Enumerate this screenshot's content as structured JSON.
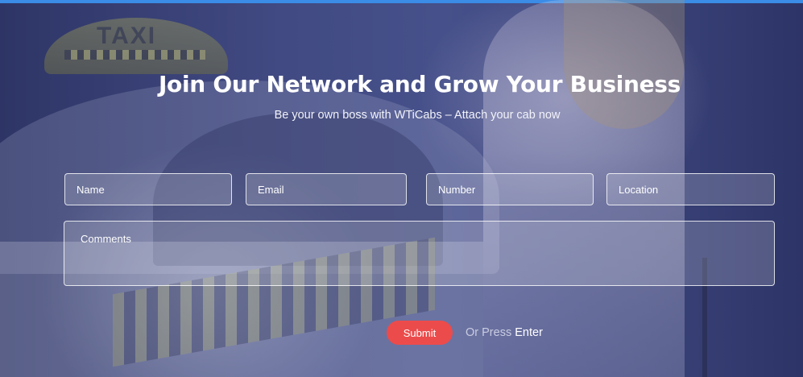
{
  "hero": {
    "title": "Join Our Network and Grow Your Business",
    "subtitle": "Be your own boss with WTiCabs – Attach your cab now",
    "background_sign_text": "TAXI"
  },
  "form": {
    "name_placeholder": "Name",
    "email_placeholder": "Email",
    "number_placeholder": "Number",
    "location_placeholder": "Location",
    "comments_placeholder": "Comments",
    "submit_label": "Submit",
    "press_prefix": "Or Press",
    "press_key": "Enter"
  },
  "colors": {
    "top_accent": "#3a8ce6",
    "overlay": "#3a4379",
    "submit_button": "#ec4b4b"
  }
}
